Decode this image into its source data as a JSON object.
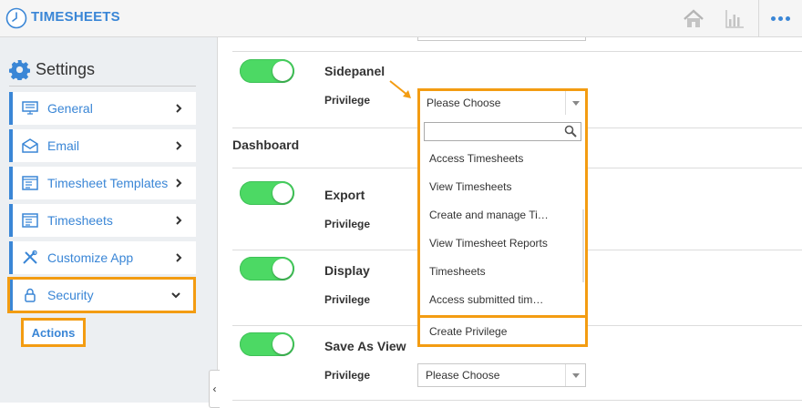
{
  "app": {
    "title": "TIMESHEETS"
  },
  "topbar": {
    "icons": [
      "clock-logo-icon",
      "home-icon",
      "bar-chart-icon",
      "more-dots-icon"
    ]
  },
  "sidebar": {
    "title": "Settings",
    "items": [
      {
        "label": "General",
        "icon": "monitor-icon"
      },
      {
        "label": "Email",
        "icon": "envelope-icon"
      },
      {
        "label": "Timesheet Templates",
        "icon": "template-icon"
      },
      {
        "label": "Timesheets",
        "icon": "list-icon"
      },
      {
        "label": "Customize App",
        "icon": "tools-icon"
      },
      {
        "label": "Security",
        "icon": "lock-icon",
        "expanded": true
      }
    ],
    "sub_item": "Actions"
  },
  "main": {
    "sidepanel": {
      "title": "Sidepanel",
      "privilege_label": "Privilege",
      "enabled": true
    },
    "dashboard_section": "Dashboard",
    "export": {
      "title": "Export",
      "privilege_label": "Privilege",
      "enabled": true
    },
    "display": {
      "title": "Display",
      "privilege_label": "Privilege",
      "enabled": true
    },
    "save_as_view": {
      "title": "Save As View",
      "privilege_label": "Privilege",
      "enabled": true,
      "select_value": "Please Choose"
    }
  },
  "dropdown": {
    "selected": "Please Choose",
    "search_placeholder": "",
    "options": [
      "Access Timesheets",
      "View Timesheets",
      "Create and manage Ti…",
      "View Timesheet Reports",
      "Timesheets",
      "Access submitted tim…"
    ],
    "create_label": "Create Privilege"
  },
  "colors": {
    "accent": "#3a86d6",
    "highlight": "#f39c12",
    "toggle_on": "#4cd964"
  }
}
